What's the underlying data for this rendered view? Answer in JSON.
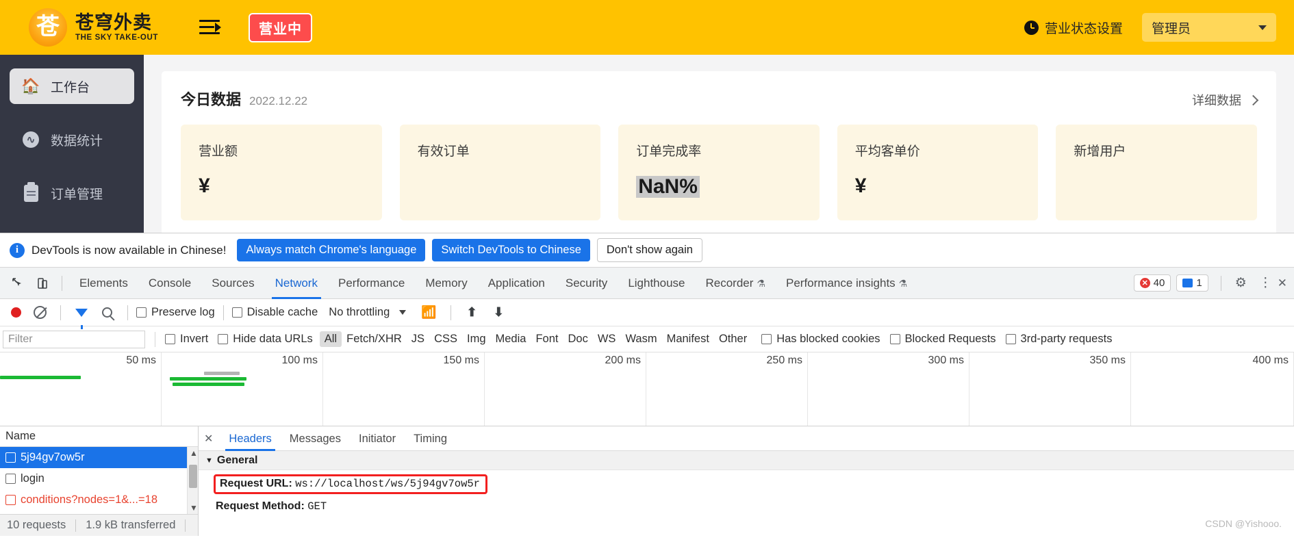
{
  "app": {
    "header": {
      "logo_cn": "苍穹外卖",
      "logo_en": "THE SKY TAKE-OUT",
      "logo_glyph": "苍",
      "status_pill": "营业中",
      "biz_status_label": "营业状态设置",
      "user_label": "管理员",
      "brand_color": "#ffc200",
      "pill_color": "#fd4c4c"
    },
    "sidebar": {
      "items": [
        {
          "label": "工作台",
          "icon": "home-icon",
          "active": true
        },
        {
          "label": "数据统计",
          "icon": "chart-circle-icon",
          "active": false
        },
        {
          "label": "订单管理",
          "icon": "clipboard-icon",
          "active": false
        }
      ]
    },
    "card": {
      "title": "今日数据",
      "date": "2022.12.22",
      "more_label": "详细数据",
      "tiles": [
        {
          "label": "营业额",
          "value": "¥",
          "highlighted": false
        },
        {
          "label": "有效订单",
          "value": "",
          "highlighted": false
        },
        {
          "label": "订单完成率",
          "value": "NaN%",
          "highlighted": true
        },
        {
          "label": "平均客单价",
          "value": "¥",
          "highlighted": false
        },
        {
          "label": "新增用户",
          "value": "",
          "highlighted": false
        }
      ]
    }
  },
  "devtools": {
    "notice": {
      "text": "DevTools is now available in Chinese!",
      "btn_always": "Always match Chrome's language",
      "btn_switch": "Switch DevTools to Chinese",
      "btn_dismiss": "Don't show again"
    },
    "tabs": [
      {
        "label": "Elements",
        "selected": false,
        "flask": false
      },
      {
        "label": "Console",
        "selected": false,
        "flask": false
      },
      {
        "label": "Sources",
        "selected": false,
        "flask": false
      },
      {
        "label": "Network",
        "selected": true,
        "flask": false
      },
      {
        "label": "Performance",
        "selected": false,
        "flask": false
      },
      {
        "label": "Memory",
        "selected": false,
        "flask": false
      },
      {
        "label": "Application",
        "selected": false,
        "flask": false
      },
      {
        "label": "Security",
        "selected": false,
        "flask": false
      },
      {
        "label": "Lighthouse",
        "selected": false,
        "flask": false
      },
      {
        "label": "Recorder",
        "selected": false,
        "flask": true
      },
      {
        "label": "Performance insights",
        "selected": false,
        "flask": true
      }
    ],
    "counters": {
      "errors": "40",
      "messages": "1"
    },
    "toolbar": {
      "preserve_log": "Preserve log",
      "disable_cache": "Disable cache",
      "throttling": "No throttling"
    },
    "filterbar": {
      "placeholder": "Filter",
      "invert": "Invert",
      "hide_data_urls": "Hide data URLs",
      "types": [
        "All",
        "Fetch/XHR",
        "JS",
        "CSS",
        "Img",
        "Media",
        "Font",
        "Doc",
        "WS",
        "Wasm",
        "Manifest",
        "Other"
      ],
      "active_type": "All",
      "has_blocked_cookies": "Has blocked cookies",
      "blocked_requests": "Blocked Requests",
      "third_party": "3rd-party requests"
    },
    "timeline": {
      "ticks": [
        "50 ms",
        "100 ms",
        "150 ms",
        "200 ms",
        "250 ms",
        "300 ms",
        "350 ms",
        "400 ms"
      ]
    },
    "requests": {
      "column_name": "Name",
      "rows": [
        {
          "name": "5j94gv7ow5r",
          "selected": true,
          "error": false
        },
        {
          "name": "login",
          "selected": false,
          "error": false
        },
        {
          "name": "conditions?nodes=1&...=18",
          "selected": false,
          "error": true
        }
      ],
      "status": {
        "requests": "10 requests",
        "transferred": "1.9 kB transferred"
      }
    },
    "details": {
      "tabs": [
        {
          "label": "Headers",
          "selected": true
        },
        {
          "label": "Messages",
          "selected": false
        },
        {
          "label": "Initiator",
          "selected": false
        },
        {
          "label": "Timing",
          "selected": false
        }
      ],
      "group_general": "General",
      "fields": [
        {
          "key": "Request URL:",
          "value": "ws://localhost/ws/5j94gv7ow5r",
          "highlighted": true
        },
        {
          "key": "Request Method:",
          "value": "GET",
          "highlighted": false
        }
      ]
    }
  },
  "watermark": "CSDN @Yishooo."
}
